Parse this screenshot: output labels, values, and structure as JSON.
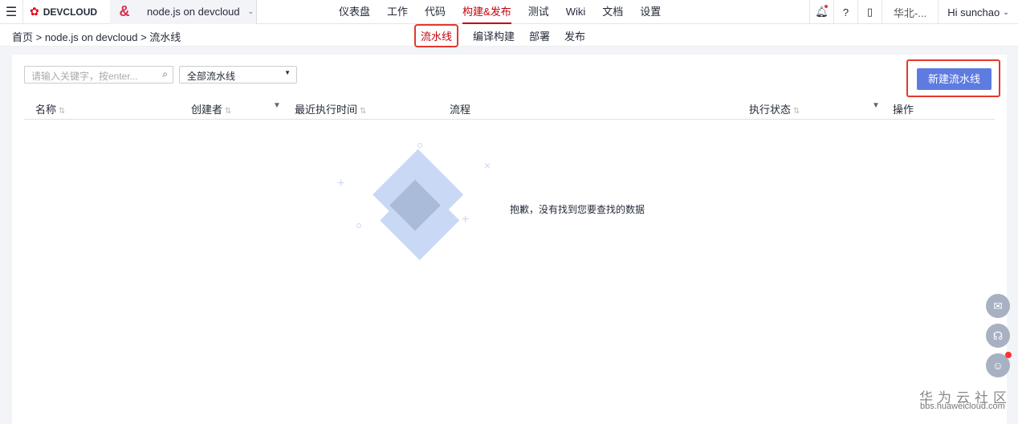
{
  "header": {
    "brand": "DEVCLOUD",
    "project": "node.js on devcloud",
    "nav": [
      "仪表盘",
      "工作",
      "代码",
      "构建&发布",
      "测试",
      "Wiki",
      "文档",
      "设置"
    ],
    "active_nav": "构建&发布",
    "region": "华北-...",
    "user": "Hi sunchao"
  },
  "breadcrumb": "首页 > node.js on devcloud > 流水线",
  "subnav": [
    "流水线",
    "编译构建",
    "部署",
    "发布"
  ],
  "toolbar": {
    "search_placeholder": "请输入关键字，按enter...",
    "filter_value": "全部流水线",
    "new_button": "新建流水线"
  },
  "table": {
    "columns": [
      "名称",
      "创建者",
      "最近执行时间",
      "流程",
      "执行状态",
      "操作"
    ],
    "empty_text": "抱歉，没有找到您要查找的数据"
  },
  "watermark": {
    "title": "华为云社区",
    "url": "bbs.huaweicloud.com"
  }
}
